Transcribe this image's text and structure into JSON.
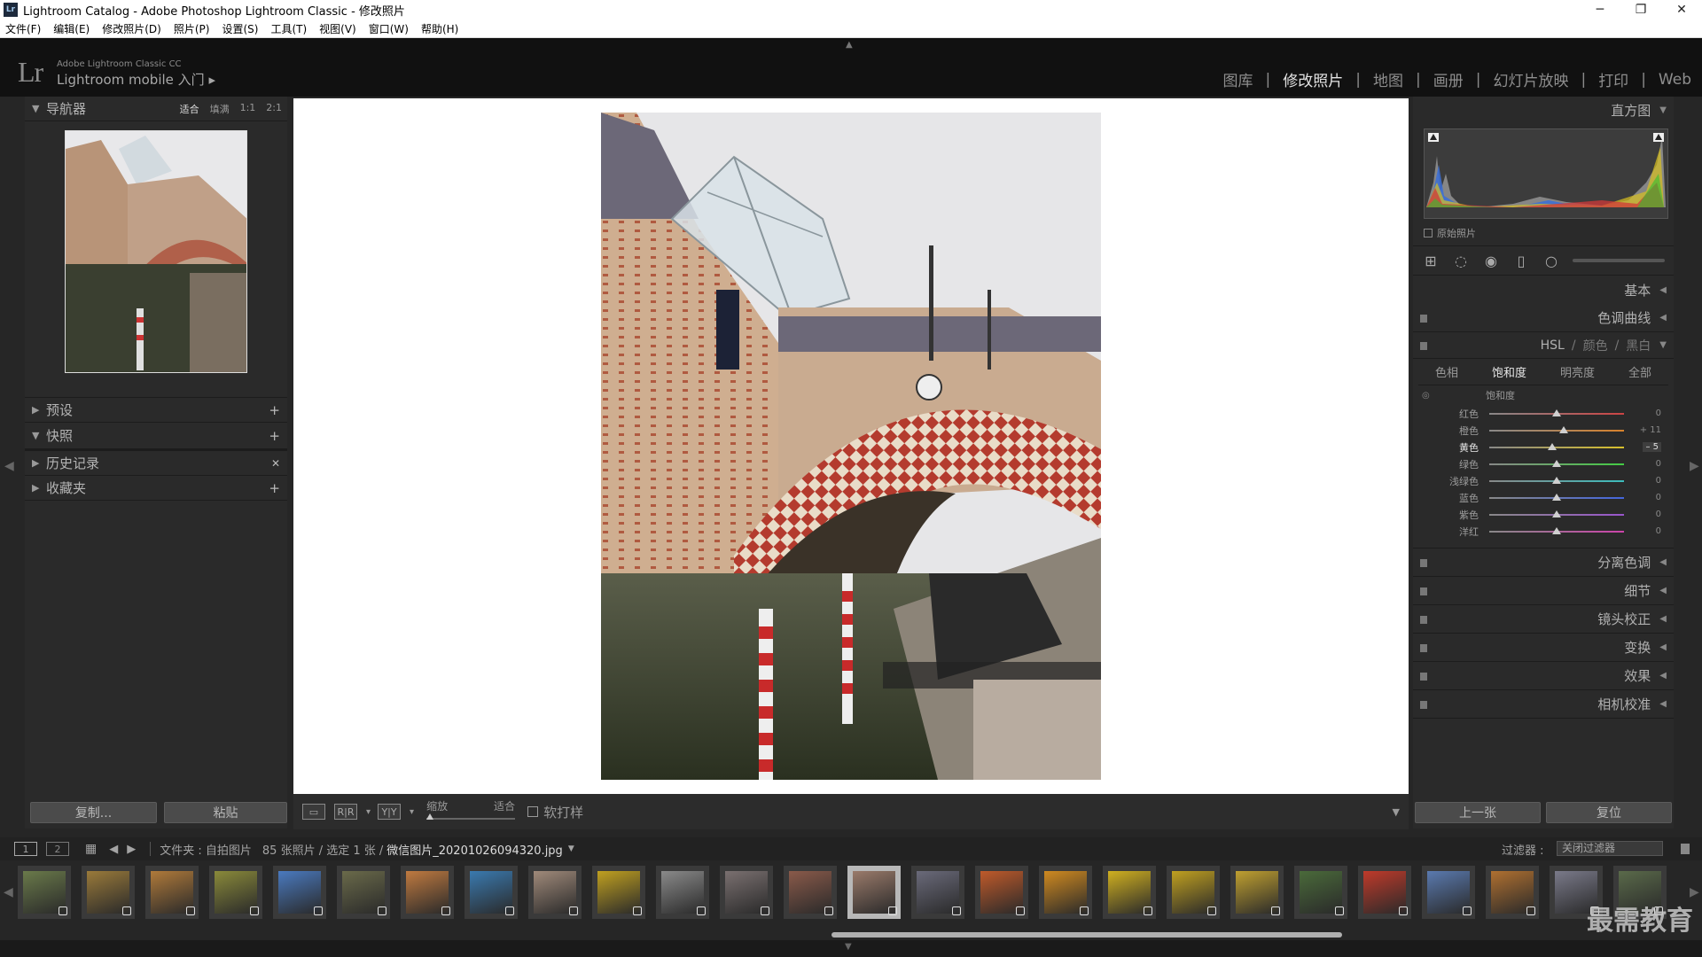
{
  "window": {
    "title": "Lightroom Catalog - Adobe Photoshop Lightroom Classic - 修改照片",
    "icon_label": "Lr",
    "minimize": "─",
    "maximize": "❐",
    "close": "✕"
  },
  "menu": [
    "文件(F)",
    "编辑(E)",
    "修改照片(D)",
    "照片(P)",
    "设置(S)",
    "工具(T)",
    "视图(V)",
    "窗口(W)",
    "帮助(H)"
  ],
  "identity": {
    "logo": "Lr",
    "line1": "Adobe Lightroom Classic CC",
    "line2": "Lightroom mobile 入门",
    "play": "▸"
  },
  "modules": [
    "图库",
    "修改照片",
    "地图",
    "画册",
    "幻灯片放映",
    "打印",
    "Web"
  ],
  "active_module": "修改照片",
  "left": {
    "navigator": {
      "title": "导航器",
      "opts": [
        "适合",
        "填满",
        "1:1",
        "2:1"
      ]
    },
    "panels": [
      {
        "title": "预设",
        "action": "+"
      },
      {
        "title": "快照",
        "action": "+"
      },
      {
        "title": "历史记录",
        "action": "✕"
      },
      {
        "title": "收藏夹",
        "action": "+"
      }
    ],
    "copy_btn": "复制...",
    "paste_btn": "粘贴"
  },
  "toolbar": {
    "zoom_label": "缩放",
    "zoom_value": "适合",
    "softproof": "软打样",
    "view_a": "R|R",
    "view_b": "Y|Y"
  },
  "right": {
    "histogram": {
      "title": "直方图",
      "original": "原始照片"
    },
    "sections_top": [
      {
        "title": "基本"
      },
      {
        "title": "色调曲线"
      }
    ],
    "hsl": {
      "hsl": "HSL",
      "color": "颜色",
      "bw": "黑白",
      "sep": "/"
    },
    "hsl_tabs": [
      "色相",
      "饱和度",
      "明亮度",
      "全部"
    ],
    "hsl_active": "饱和度",
    "hsl_group": "饱和度",
    "sliders": [
      {
        "label": "红色",
        "value": "0",
        "pos": 0.5,
        "color": "#c44",
        "active": false
      },
      {
        "label": "橙色",
        "value": "+ 11",
        "pos": 0.55,
        "color": "#d8822c",
        "active": false
      },
      {
        "label": "黄色",
        "value": "– 5",
        "pos": 0.47,
        "color": "#d8c02c",
        "active": true
      },
      {
        "label": "绿色",
        "value": "0",
        "pos": 0.5,
        "color": "#4c4",
        "active": false
      },
      {
        "label": "浅绿色",
        "value": "0",
        "pos": 0.5,
        "color": "#3cbcbc",
        "active": false
      },
      {
        "label": "蓝色",
        "value": "0",
        "pos": 0.5,
        "color": "#4466dd",
        "active": false
      },
      {
        "label": "紫色",
        "value": "0",
        "pos": 0.5,
        "color": "#9955cc",
        "active": false
      },
      {
        "label": "洋红",
        "value": "0",
        "pos": 0.5,
        "color": "#cc44aa",
        "active": false
      }
    ],
    "sections_bottom": [
      {
        "title": "分离色调"
      },
      {
        "title": "细节"
      },
      {
        "title": "镜头校正"
      },
      {
        "title": "变换"
      },
      {
        "title": "效果"
      },
      {
        "title": "相机校准"
      }
    ],
    "prev_btn": "上一张",
    "reset_btn": "复位"
  },
  "filmbar": {
    "page1": "1",
    "page2": "2",
    "path": "文件夹 : 自拍图片",
    "count": "85 张照片 / 选定 1 张 /",
    "filename": "微信图片_20201026094320.jpg",
    "filter_label": "过滤器 :",
    "filter_value": "关闭过滤器"
  },
  "thumbs": [
    {
      "color": "#6a7a4a",
      "selected": false
    },
    {
      "color": "#9a7a3a",
      "selected": false
    },
    {
      "color": "#b07a3a",
      "selected": false
    },
    {
      "color": "#8a8a3a",
      "selected": false
    },
    {
      "color": "#4a7ac0",
      "selected": false
    },
    {
      "color": "#6a6a4a",
      "selected": false
    },
    {
      "color": "#c07a40",
      "selected": false
    },
    {
      "color": "#3a7ab0",
      "selected": false
    },
    {
      "color": "#a08a7a",
      "selected": false
    },
    {
      "color": "#c0a020",
      "selected": false
    },
    {
      "color": "#8a8a8a",
      "selected": false
    },
    {
      "color": "#7a7070",
      "selected": false
    },
    {
      "color": "#8a5a4a",
      "selected": false
    },
    {
      "color": "#9a7a6a",
      "selected": true
    },
    {
      "color": "#6a6a7a",
      "selected": false
    },
    {
      "color": "#c05a2a",
      "selected": false
    },
    {
      "color": "#d08a20",
      "selected": false
    },
    {
      "color": "#d0b020",
      "selected": false
    },
    {
      "color": "#c0a020",
      "selected": false
    },
    {
      "color": "#c0a030",
      "selected": false
    },
    {
      "color": "#4a6a3a",
      "selected": false
    },
    {
      "color": "#c03a2a",
      "selected": false
    },
    {
      "color": "#5a7ab0",
      "selected": false
    },
    {
      "color": "#b07030",
      "selected": false
    },
    {
      "color": "#7a7a8a",
      "selected": false
    },
    {
      "color": "#5a6a4a",
      "selected": false
    }
  ],
  "watermark": "最需教育",
  "colors": {
    "accent": "#e3e3e3",
    "panel": "#2a2a2a",
    "canvas": "#ffffff"
  }
}
